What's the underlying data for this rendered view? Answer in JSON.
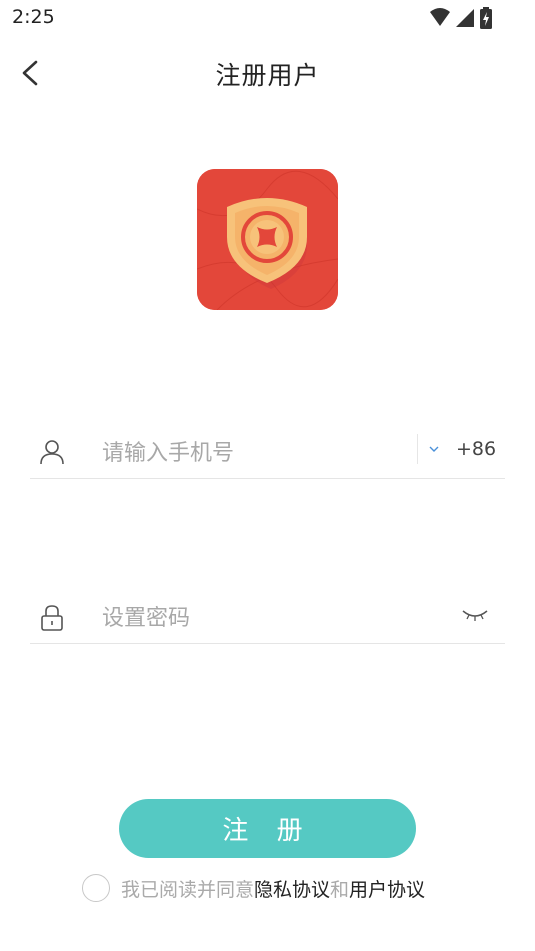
{
  "status_bar": {
    "time": "2:25"
  },
  "header": {
    "title": "注册用户"
  },
  "form": {
    "phone_placeholder": "请输入手机号",
    "country_code": "+86",
    "password_placeholder": "设置密码"
  },
  "register_button": {
    "label": "注 册"
  },
  "agreement": {
    "prefix": "我已阅读并同意",
    "privacy_link": "隐私协议",
    "conjunction": "和",
    "user_link": "用户协议"
  },
  "colors": {
    "accent": "#55c9c3",
    "logo_red": "#e3473a",
    "logo_shield": "#f7c27a"
  },
  "icons": [
    "back-arrow-icon",
    "user-icon",
    "lock-icon",
    "eye-closed-icon",
    "chevron-down-icon",
    "wifi-icon",
    "cellular-signal-icon",
    "battery-charging-icon"
  ]
}
